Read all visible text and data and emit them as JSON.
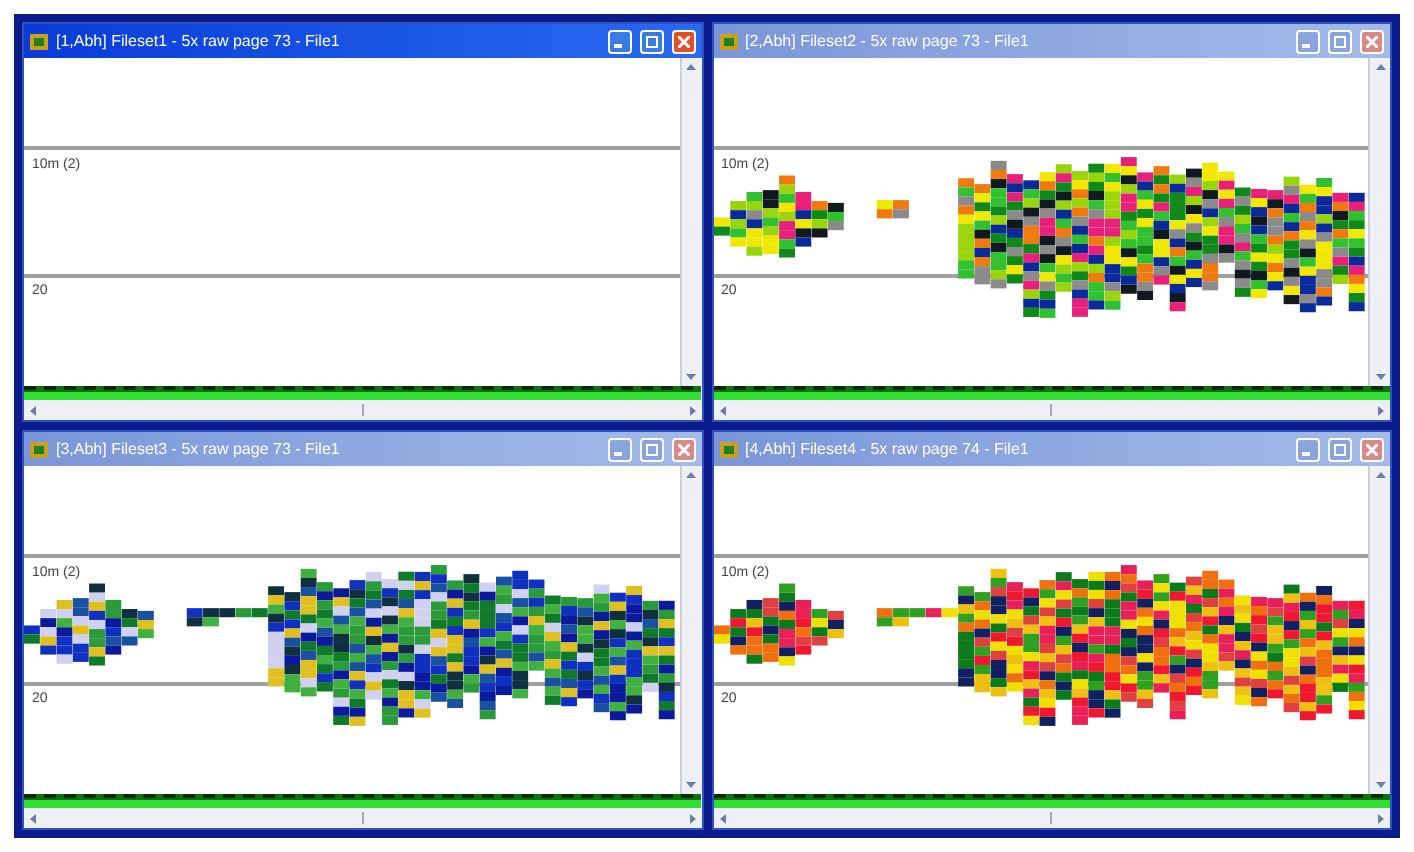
{
  "windows": [
    {
      "title": "[1,Abh] Fileset1 - 5x raw page 73 - File1",
      "selected": true,
      "kind": "empty",
      "labels": [
        "10m (2)",
        "20"
      ]
    },
    {
      "title": "[2,Abh] Fileset2 - 5x raw page 73 - File1",
      "selected": false,
      "kind": "mixed",
      "labels": [
        "10m (2)",
        "20"
      ]
    },
    {
      "title": "[3,Abh] Fileset3 - 5x raw page 73 - File1",
      "selected": false,
      "kind": "cool",
      "labels": [
        "10m (2)",
        "20"
      ]
    },
    {
      "title": "[4,Abh] Fileset4 - 5x raw page 74 - File1",
      "selected": false,
      "kind": "warm",
      "labels": [
        "10m (2)",
        "20"
      ]
    }
  ]
}
